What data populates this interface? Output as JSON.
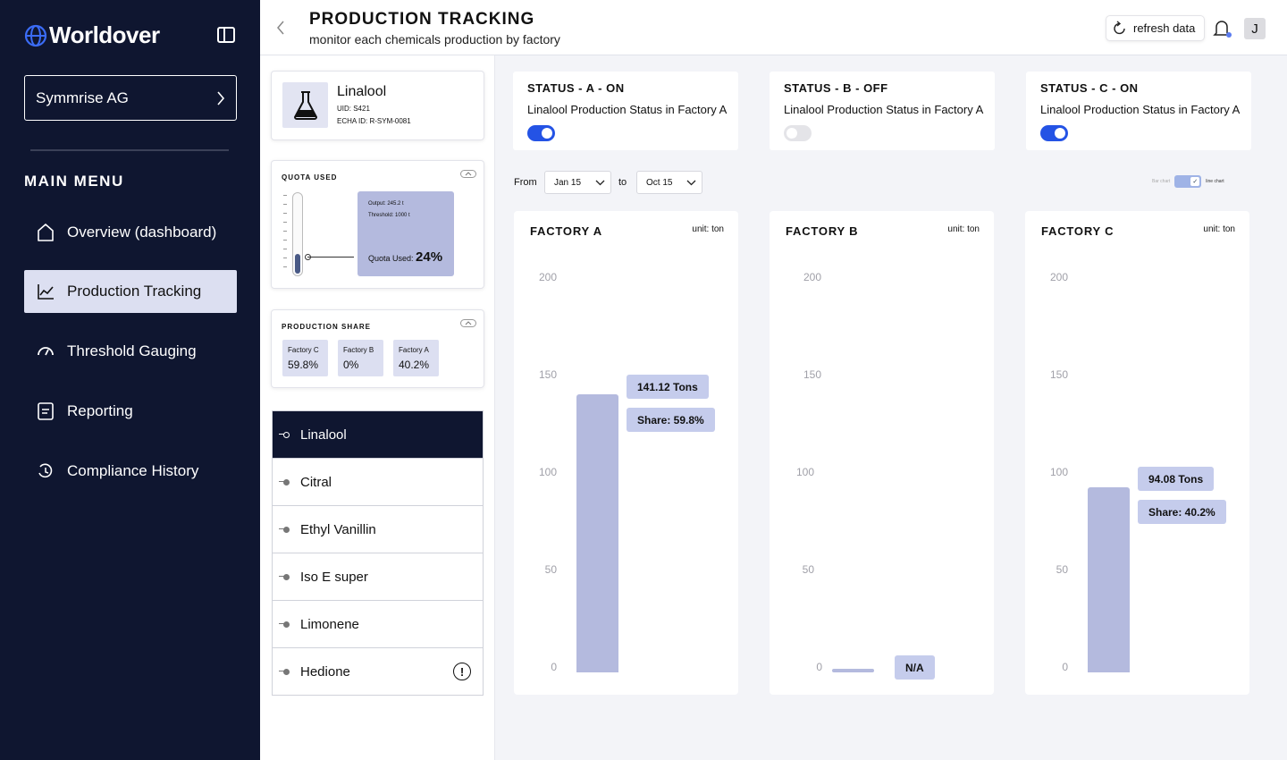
{
  "app": {
    "name": "Worldover"
  },
  "sidebar": {
    "org": "Symmrise AG",
    "menu_title": "MAIN MENU",
    "items": [
      {
        "label": "Overview (dashboard)",
        "icon": "home-icon"
      },
      {
        "label": "Production Tracking",
        "icon": "line-chart-icon",
        "active": true
      },
      {
        "label": "Threshold Gauging",
        "icon": "gauge-icon"
      },
      {
        "label": "Reporting",
        "icon": "document-icon"
      },
      {
        "label": "Compliance History",
        "icon": "history-icon"
      }
    ]
  },
  "header": {
    "title": "PRODUCTION TRACKING",
    "subtitle": "monitor each chemicals production by factory",
    "refresh_label": "refresh data",
    "avatar_initial": "J"
  },
  "chemical": {
    "name": "Linalool",
    "uid": "UID: S421",
    "echa": "ECHA ID: R-SYM-0081"
  },
  "quota": {
    "title": "QUOTA USED",
    "output": "Output: 245.2 t",
    "threshold": "Threshold: 1000 t",
    "used_label": "Quota Used:",
    "used_value": "24%",
    "fraction": 0.245
  },
  "share": {
    "title": "PRODUCTION SHARE",
    "chips": [
      {
        "label": "Factory C",
        "value": "59.8%"
      },
      {
        "label": "Factory B",
        "value": "0%"
      },
      {
        "label": "Factory A",
        "value": "40.2%"
      }
    ]
  },
  "chemicals_list": [
    {
      "name": "Linalool",
      "active": true
    },
    {
      "name": "Citral"
    },
    {
      "name": "Ethyl Vanillin"
    },
    {
      "name": "Iso E super"
    },
    {
      "name": "Limonene"
    },
    {
      "name": "Hedione",
      "warning": true
    }
  ],
  "status_cards": [
    {
      "title": "STATUS - A - ON",
      "desc": "Linalool Production Status in Factory A",
      "on": true
    },
    {
      "title": "STATUS - B - OFF",
      "desc": "Linalool Production Status in Factory A",
      "on": false
    },
    {
      "title": "STATUS - C - ON",
      "desc": "Linalool Production Status in Factory A",
      "on": true
    }
  ],
  "filter": {
    "from_label": "From",
    "from_value": "Jan 15",
    "to_label": "to",
    "to_value": "Oct 15",
    "toggle_left": "Bar chart",
    "toggle_right": "line chart"
  },
  "chart_data": [
    {
      "type": "bar",
      "title": "FACTORY A",
      "unit": "unit: ton",
      "yticks": [
        "200",
        "150",
        "100",
        "50",
        "0"
      ],
      "ylim": [
        0,
        200
      ],
      "value": 141.12,
      "value_label": "141.12 Tons",
      "share_label": "Share: 59.8%"
    },
    {
      "type": "bar",
      "title": "FACTORY B",
      "unit": "unit: ton",
      "yticks": [
        "200",
        "150",
        "100",
        "50",
        "0"
      ],
      "ylim": [
        0,
        200
      ],
      "value": 0,
      "value_label": "N/A",
      "share_label": ""
    },
    {
      "type": "bar",
      "title": "FACTORY C",
      "unit": "unit: ton",
      "yticks": [
        "200",
        "150",
        "100",
        "50",
        "0"
      ],
      "ylim": [
        0,
        200
      ],
      "value": 94.08,
      "value_label": "94.08 Tons",
      "share_label": "Share: 40.2%"
    }
  ]
}
